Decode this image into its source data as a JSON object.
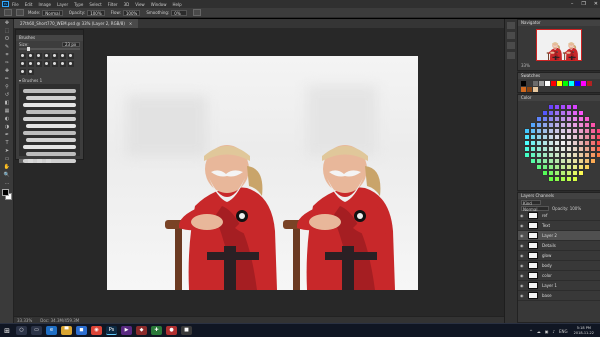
{
  "menubar": {
    "app_icon": "Ps",
    "items": [
      "File",
      "Edit",
      "Image",
      "Layer",
      "Type",
      "Select",
      "Filter",
      "3D",
      "View",
      "Window",
      "Help"
    ],
    "controls": [
      "minimize-icon",
      "restore-icon",
      "close-icon"
    ]
  },
  "options": {
    "mode_label": "Mode:",
    "mode_value": "Normal",
    "opacity_label": "Opacity:",
    "opacity_value": "100%",
    "flow_label": "Flow:",
    "flow_value": "100%",
    "smoothing_label": "Smoothing:",
    "smoothing_value": "0%"
  },
  "document": {
    "tab_title": "27th60_Short770_WEM.psd @ 33% (Layer 2, RGB/8)",
    "tab_close": "×"
  },
  "tools": [
    "move-icon",
    "marquee-icon",
    "lasso-icon",
    "quick-select-icon",
    "crop-icon",
    "eyedropper-icon",
    "healing-icon",
    "brush-icon",
    "clone-stamp-icon",
    "history-brush-icon",
    "eraser-icon",
    "gradient-icon",
    "blur-icon",
    "dodge-icon",
    "pen-icon",
    "type-icon",
    "path-select-icon",
    "rectangle-icon",
    "hand-icon",
    "zoom-icon",
    "edit-toolbar-icon"
  ],
  "tool_glyphs": [
    "✥",
    "⬚",
    "ʘ",
    "✎",
    "⌗",
    "✑",
    "✚",
    "✏",
    "⚲",
    "↺",
    "◧",
    "▦",
    "◐",
    "◑",
    "✒",
    "T",
    "➤",
    "▭",
    "✋",
    "🔍",
    "…"
  ],
  "brush_panel": {
    "title": "Brushes",
    "size_label": "Size:",
    "size_value": "23 px",
    "group_label": "Brushes 1",
    "strokes": 11
  },
  "status": {
    "zoom": "33.33%",
    "doc_size": "Doc: 34.3M/459.3M"
  },
  "right_panels": {
    "navigator_title": "Navigator",
    "navigator_zoom": "33%",
    "swatches_title": "Swatches",
    "color_title": "Color",
    "layers_tabs": "Layers  Channels",
    "layers_kind": "Kind",
    "layers_mode": "Normal",
    "layers_opacity": "Opacity: 100%",
    "layers": [
      {
        "name": "ref",
        "selected": false
      },
      {
        "name": "Text",
        "selected": false
      },
      {
        "name": "Layer 2",
        "selected": true
      },
      {
        "name": "Details",
        "selected": false
      },
      {
        "name": "glow",
        "selected": false
      },
      {
        "name": "body",
        "selected": false
      },
      {
        "name": "color",
        "selected": false
      },
      {
        "name": "Layer 1",
        "selected": false
      },
      {
        "name": "base",
        "selected": false
      }
    ],
    "swatch_colors": [
      "#000000",
      "#3b3b3b",
      "#6b6b6b",
      "#9e9e9e",
      "#ffffff",
      "#ff0000",
      "#ffff00",
      "#00ff00",
      "#00ffff",
      "#0000ff",
      "#ff00ff",
      "#b22222",
      "#d2691e",
      "#8b4513",
      "#e8c9a0"
    ]
  },
  "canvas": {
    "bg": "#f2f2f2",
    "robe": "#c8282a",
    "skin": "#e8b79a",
    "beard": "#eeeeee",
    "staff": "#6b3a22"
  },
  "taskbar": {
    "start": "⊞",
    "icons": [
      {
        "name": "search-taskbar-icon",
        "glyph": "○",
        "color": "#2b3347"
      },
      {
        "name": "taskview-icon",
        "glyph": "▭",
        "color": "#2b3347"
      },
      {
        "name": "edge-icon",
        "glyph": "e",
        "color": "#1f6fc5"
      },
      {
        "name": "explorer-icon",
        "glyph": "▀",
        "color": "#d8a431"
      },
      {
        "name": "store-icon",
        "glyph": "◼",
        "color": "#2d6fd1"
      },
      {
        "name": "chrome-icon",
        "glyph": "◉",
        "color": "#dc4437"
      },
      {
        "name": "photoshop-taskbar-icon",
        "glyph": "Ps",
        "color": "#0c2a44"
      },
      {
        "name": "media-icon",
        "glyph": "▶",
        "color": "#5a2a82"
      },
      {
        "name": "app-icon",
        "glyph": "◆",
        "color": "#8b2b2b"
      },
      {
        "name": "app2-icon",
        "glyph": "✚",
        "color": "#2b7a3a"
      },
      {
        "name": "app3-icon",
        "glyph": "●",
        "color": "#b03030"
      },
      {
        "name": "app4-icon",
        "glyph": "■",
        "color": "#3a3a3a"
      }
    ],
    "tray": [
      "^",
      "☁",
      "▣",
      "♪",
      "ENG"
    ],
    "time": "5:18 PM",
    "date": "2018-11-22"
  }
}
